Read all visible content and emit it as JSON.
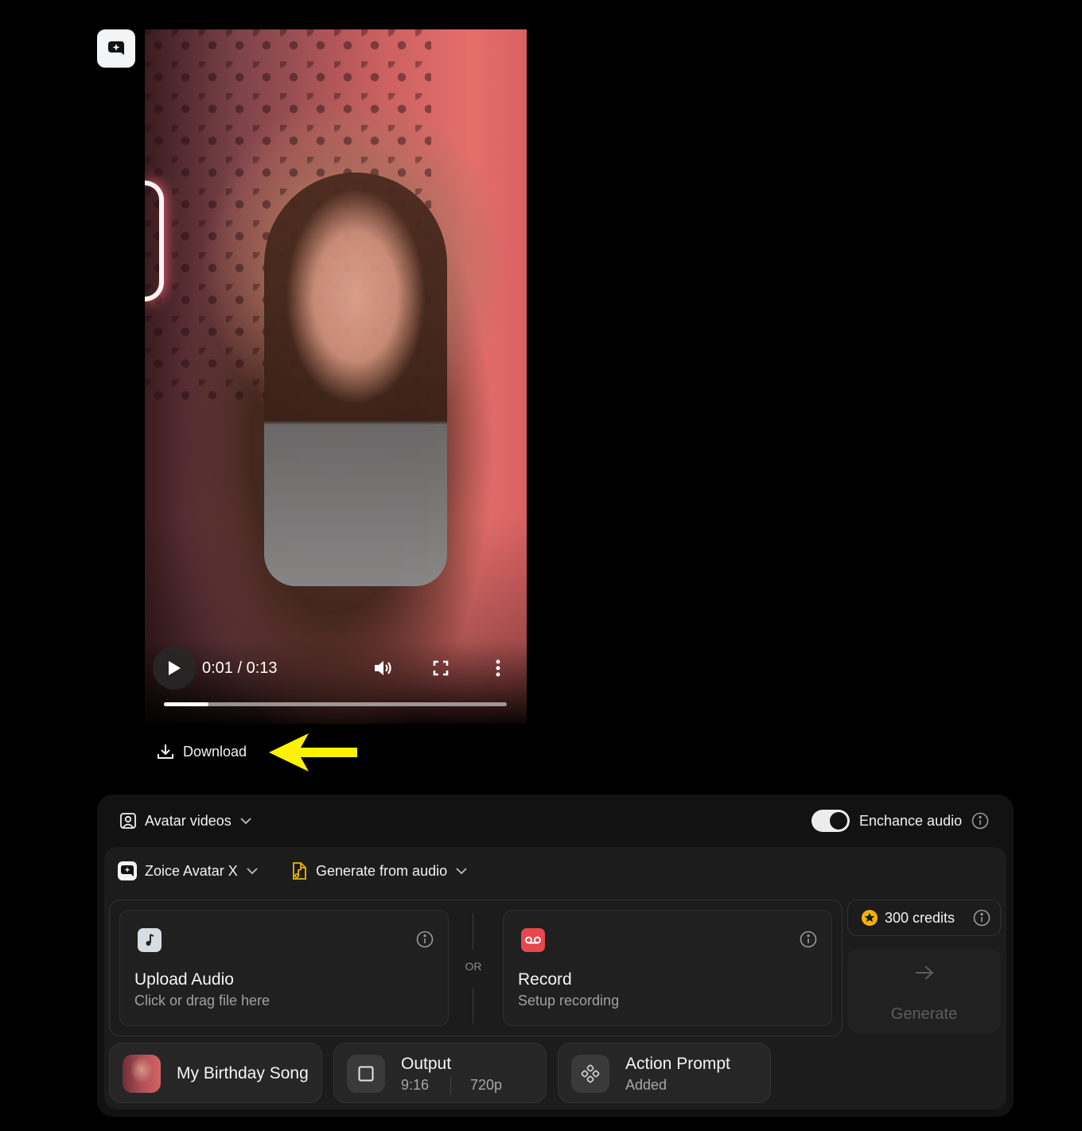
{
  "video": {
    "time": "0:01 / 0:13",
    "progress": 0.13
  },
  "download_label": "Download",
  "mode_selector": {
    "label": "Avatar videos"
  },
  "enhance_audio": {
    "label": "Enchance audio",
    "enabled": true
  },
  "model_selector": {
    "label": "Zoice Avatar X"
  },
  "source_selector": {
    "label": "Generate from audio"
  },
  "upload_card": {
    "title": "Upload Audio",
    "subtitle": "Click or drag file here"
  },
  "or_label": "OR",
  "record_card": {
    "title": "Record",
    "subtitle": "Setup recording"
  },
  "credits": {
    "label": "300 credits"
  },
  "generate": {
    "label": "Generate"
  },
  "chips": {
    "song": {
      "title": "My Birthday Song"
    },
    "output": {
      "title": "Output",
      "ratio": "9:16",
      "resolution": "720p"
    },
    "action": {
      "title": "Action Prompt",
      "subtitle": "Added"
    }
  },
  "colors": {
    "background": "#000000",
    "panel": "#121212",
    "accent_record": "#e5484d",
    "credit_star": "#f5b301",
    "annotation_arrow": "#fff200"
  }
}
